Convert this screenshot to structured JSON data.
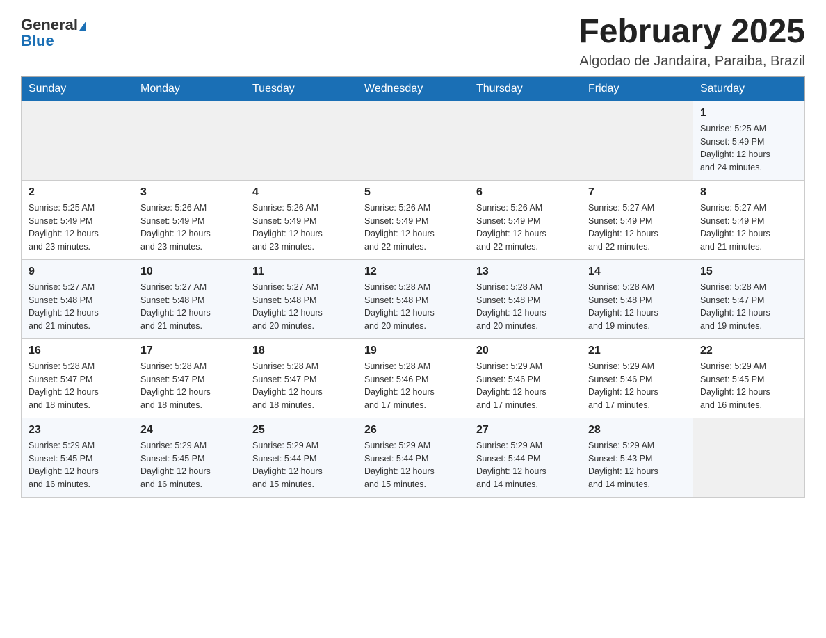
{
  "header": {
    "logo_general": "General",
    "logo_blue": "Blue",
    "month_title": "February 2025",
    "location": "Algodao de Jandaira, Paraiba, Brazil"
  },
  "weekdays": [
    "Sunday",
    "Monday",
    "Tuesday",
    "Wednesday",
    "Thursday",
    "Friday",
    "Saturday"
  ],
  "weeks": [
    [
      {
        "day": "",
        "info": ""
      },
      {
        "day": "",
        "info": ""
      },
      {
        "day": "",
        "info": ""
      },
      {
        "day": "",
        "info": ""
      },
      {
        "day": "",
        "info": ""
      },
      {
        "day": "",
        "info": ""
      },
      {
        "day": "1",
        "info": "Sunrise: 5:25 AM\nSunset: 5:49 PM\nDaylight: 12 hours\nand 24 minutes."
      }
    ],
    [
      {
        "day": "2",
        "info": "Sunrise: 5:25 AM\nSunset: 5:49 PM\nDaylight: 12 hours\nand 23 minutes."
      },
      {
        "day": "3",
        "info": "Sunrise: 5:26 AM\nSunset: 5:49 PM\nDaylight: 12 hours\nand 23 minutes."
      },
      {
        "day": "4",
        "info": "Sunrise: 5:26 AM\nSunset: 5:49 PM\nDaylight: 12 hours\nand 23 minutes."
      },
      {
        "day": "5",
        "info": "Sunrise: 5:26 AM\nSunset: 5:49 PM\nDaylight: 12 hours\nand 22 minutes."
      },
      {
        "day": "6",
        "info": "Sunrise: 5:26 AM\nSunset: 5:49 PM\nDaylight: 12 hours\nand 22 minutes."
      },
      {
        "day": "7",
        "info": "Sunrise: 5:27 AM\nSunset: 5:49 PM\nDaylight: 12 hours\nand 22 minutes."
      },
      {
        "day": "8",
        "info": "Sunrise: 5:27 AM\nSunset: 5:49 PM\nDaylight: 12 hours\nand 21 minutes."
      }
    ],
    [
      {
        "day": "9",
        "info": "Sunrise: 5:27 AM\nSunset: 5:48 PM\nDaylight: 12 hours\nand 21 minutes."
      },
      {
        "day": "10",
        "info": "Sunrise: 5:27 AM\nSunset: 5:48 PM\nDaylight: 12 hours\nand 21 minutes."
      },
      {
        "day": "11",
        "info": "Sunrise: 5:27 AM\nSunset: 5:48 PM\nDaylight: 12 hours\nand 20 minutes."
      },
      {
        "day": "12",
        "info": "Sunrise: 5:28 AM\nSunset: 5:48 PM\nDaylight: 12 hours\nand 20 minutes."
      },
      {
        "day": "13",
        "info": "Sunrise: 5:28 AM\nSunset: 5:48 PM\nDaylight: 12 hours\nand 20 minutes."
      },
      {
        "day": "14",
        "info": "Sunrise: 5:28 AM\nSunset: 5:48 PM\nDaylight: 12 hours\nand 19 minutes."
      },
      {
        "day": "15",
        "info": "Sunrise: 5:28 AM\nSunset: 5:47 PM\nDaylight: 12 hours\nand 19 minutes."
      }
    ],
    [
      {
        "day": "16",
        "info": "Sunrise: 5:28 AM\nSunset: 5:47 PM\nDaylight: 12 hours\nand 18 minutes."
      },
      {
        "day": "17",
        "info": "Sunrise: 5:28 AM\nSunset: 5:47 PM\nDaylight: 12 hours\nand 18 minutes."
      },
      {
        "day": "18",
        "info": "Sunrise: 5:28 AM\nSunset: 5:47 PM\nDaylight: 12 hours\nand 18 minutes."
      },
      {
        "day": "19",
        "info": "Sunrise: 5:28 AM\nSunset: 5:46 PM\nDaylight: 12 hours\nand 17 minutes."
      },
      {
        "day": "20",
        "info": "Sunrise: 5:29 AM\nSunset: 5:46 PM\nDaylight: 12 hours\nand 17 minutes."
      },
      {
        "day": "21",
        "info": "Sunrise: 5:29 AM\nSunset: 5:46 PM\nDaylight: 12 hours\nand 17 minutes."
      },
      {
        "day": "22",
        "info": "Sunrise: 5:29 AM\nSunset: 5:45 PM\nDaylight: 12 hours\nand 16 minutes."
      }
    ],
    [
      {
        "day": "23",
        "info": "Sunrise: 5:29 AM\nSunset: 5:45 PM\nDaylight: 12 hours\nand 16 minutes."
      },
      {
        "day": "24",
        "info": "Sunrise: 5:29 AM\nSunset: 5:45 PM\nDaylight: 12 hours\nand 16 minutes."
      },
      {
        "day": "25",
        "info": "Sunrise: 5:29 AM\nSunset: 5:44 PM\nDaylight: 12 hours\nand 15 minutes."
      },
      {
        "day": "26",
        "info": "Sunrise: 5:29 AM\nSunset: 5:44 PM\nDaylight: 12 hours\nand 15 minutes."
      },
      {
        "day": "27",
        "info": "Sunrise: 5:29 AM\nSunset: 5:44 PM\nDaylight: 12 hours\nand 14 minutes."
      },
      {
        "day": "28",
        "info": "Sunrise: 5:29 AM\nSunset: 5:43 PM\nDaylight: 12 hours\nand 14 minutes."
      },
      {
        "day": "",
        "info": ""
      }
    ]
  ]
}
